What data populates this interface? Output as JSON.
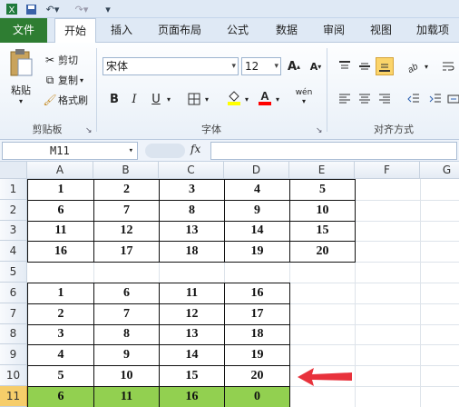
{
  "ribbon": {
    "tabs": [
      "文件",
      "开始",
      "插入",
      "页面布局",
      "公式",
      "数据",
      "审阅",
      "视图",
      "加载项"
    ],
    "clipboard": {
      "paste": "粘贴",
      "cut": "剪切",
      "copy": "复制",
      "format_painter": "格式刷",
      "group_label": "剪贴板"
    },
    "font": {
      "name": "宋体",
      "size": "12",
      "group_label": "字体",
      "phonetic": "wén"
    },
    "alignment": {
      "group_label": "对齐方式"
    },
    "colors": {
      "fill": "#ffff00",
      "font": "#ff0000",
      "file_tab": "#2e7d32",
      "highlight_row": "#92d050"
    }
  },
  "formula_bar": {
    "name_box": "M11",
    "fx_label": "fx",
    "formula": ""
  },
  "sheet": {
    "columns": [
      "A",
      "B",
      "C",
      "D",
      "E",
      "F",
      "G"
    ],
    "rows": [
      "1",
      "2",
      "3",
      "4",
      "5",
      "6",
      "7",
      "8",
      "9",
      "10",
      "11"
    ],
    "selected_row": "11",
    "table1": [
      [
        "1",
        "2",
        "3",
        "4",
        "5"
      ],
      [
        "6",
        "7",
        "8",
        "9",
        "10"
      ],
      [
        "11",
        "12",
        "13",
        "14",
        "15"
      ],
      [
        "16",
        "17",
        "18",
        "19",
        "20"
      ]
    ],
    "table2": [
      [
        "1",
        "6",
        "11",
        "16"
      ],
      [
        "2",
        "7",
        "12",
        "17"
      ],
      [
        "3",
        "8",
        "13",
        "18"
      ],
      [
        "4",
        "9",
        "14",
        "19"
      ],
      [
        "5",
        "10",
        "15",
        "20"
      ],
      [
        "6",
        "11",
        "16",
        "0"
      ]
    ],
    "annotation_arrow_color": "#e8323c"
  }
}
